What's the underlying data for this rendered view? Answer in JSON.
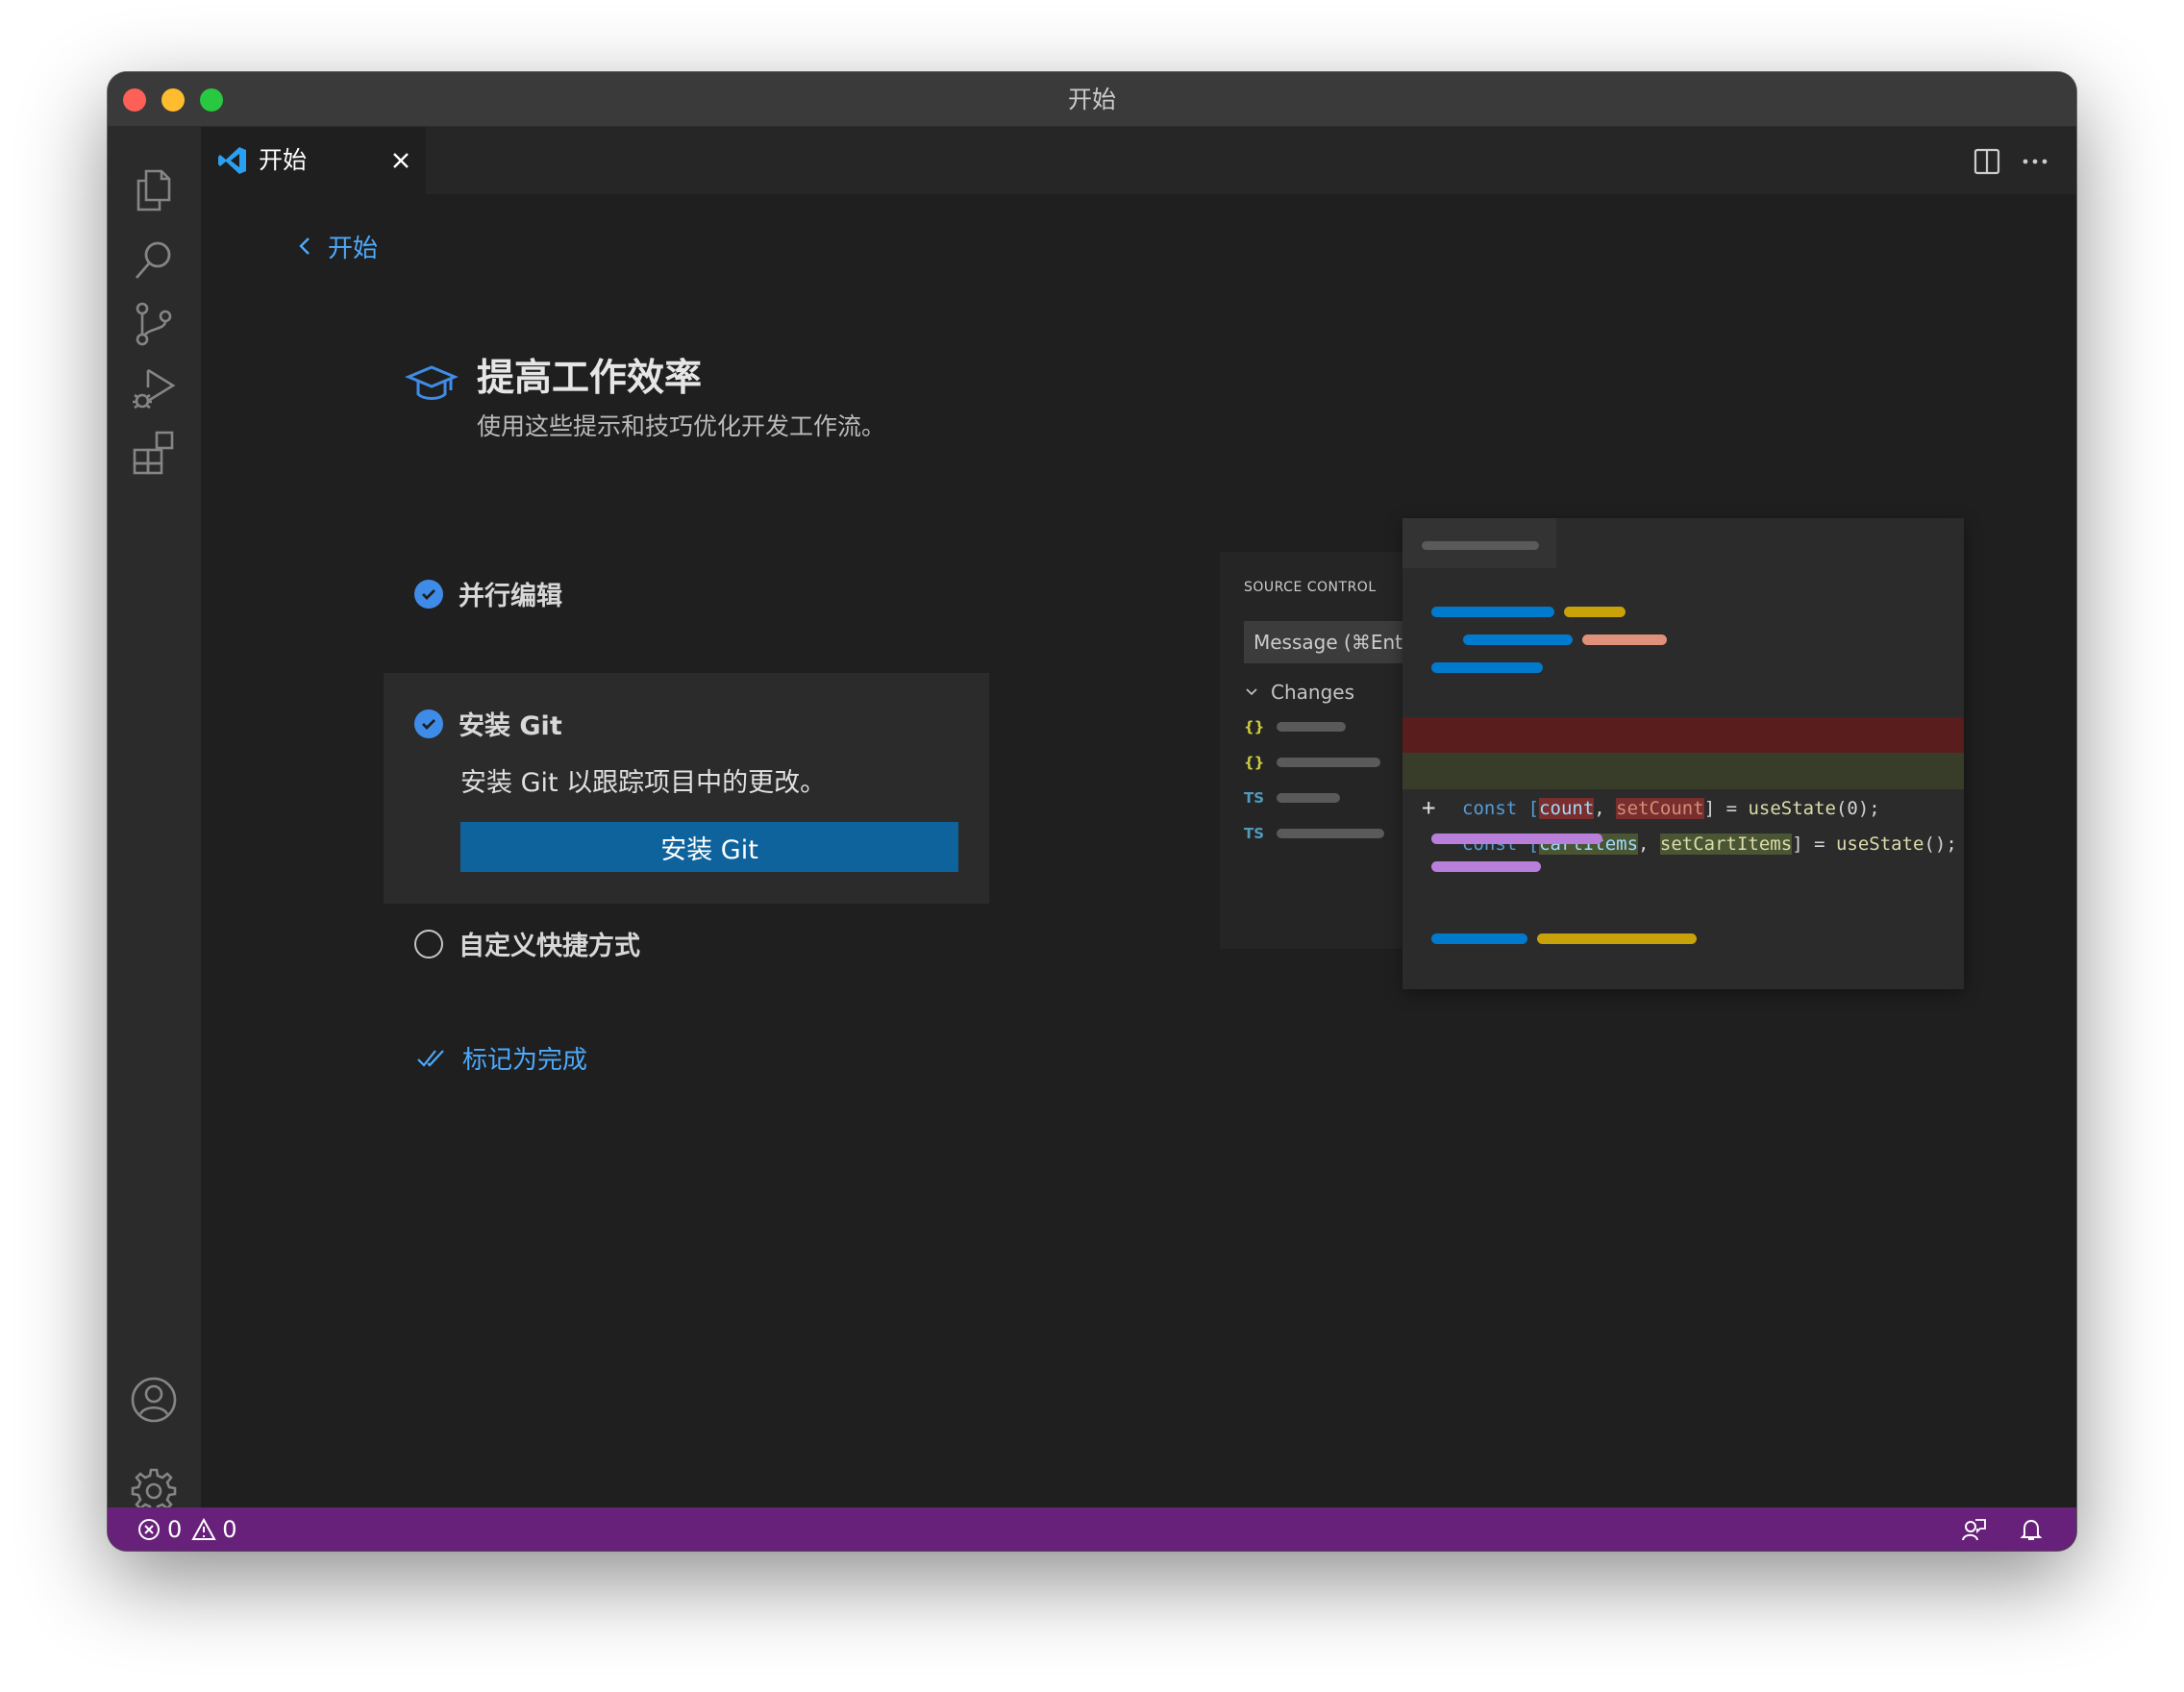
{
  "window": {
    "title": "开始"
  },
  "tabs": [
    {
      "label": "开始"
    }
  ],
  "breadcrumb": {
    "back_label": "开始"
  },
  "walkthrough": {
    "title": "提高工作效率",
    "subtitle": "使用这些提示和技巧优化开发工作流。",
    "steps": [
      {
        "label": "并行编辑",
        "done": true
      },
      {
        "label": "安装 Git",
        "done": true,
        "description": "安装 Git 以跟踪项目中的更改。",
        "button_label": "安装 Git"
      },
      {
        "label": "自定义快捷方式",
        "done": false
      }
    ],
    "mark_done_label": "标记为完成"
  },
  "illustration": {
    "panel_title": "SOURCE CONTROL",
    "message_placeholder": "Message (⌘Ente",
    "changes_label": "Changes",
    "file_glyphs": [
      "{}",
      "{}",
      "TS",
      "TS"
    ],
    "diff_removed": {
      "sign": "—",
      "prefix": "const [",
      "var1": "count",
      "sep": ", ",
      "var2": "setCount",
      "suffix": "] = ",
      "call": "useState",
      "arg": "(0);"
    },
    "diff_added": {
      "sign": "+",
      "prefix": "const [",
      "var1": "cartItems",
      "sep": ", ",
      "var2": "setCartItems",
      "suffix": "] = ",
      "call": "useState",
      "arg": "();"
    }
  },
  "statusbar": {
    "errors": "0",
    "warnings": "0"
  },
  "icons": {
    "activity": [
      "files-icon",
      "search-icon",
      "source-control-icon",
      "run-debug-icon",
      "extensions-icon",
      "account-icon",
      "settings-gear-icon"
    ],
    "editor_actions": [
      "split-editor-icon",
      "more-actions-icon"
    ]
  },
  "colors": {
    "accent": "#4daafc",
    "button": "#0e639c",
    "statusbar": "#68217a",
    "check": "#3f8ce8"
  }
}
